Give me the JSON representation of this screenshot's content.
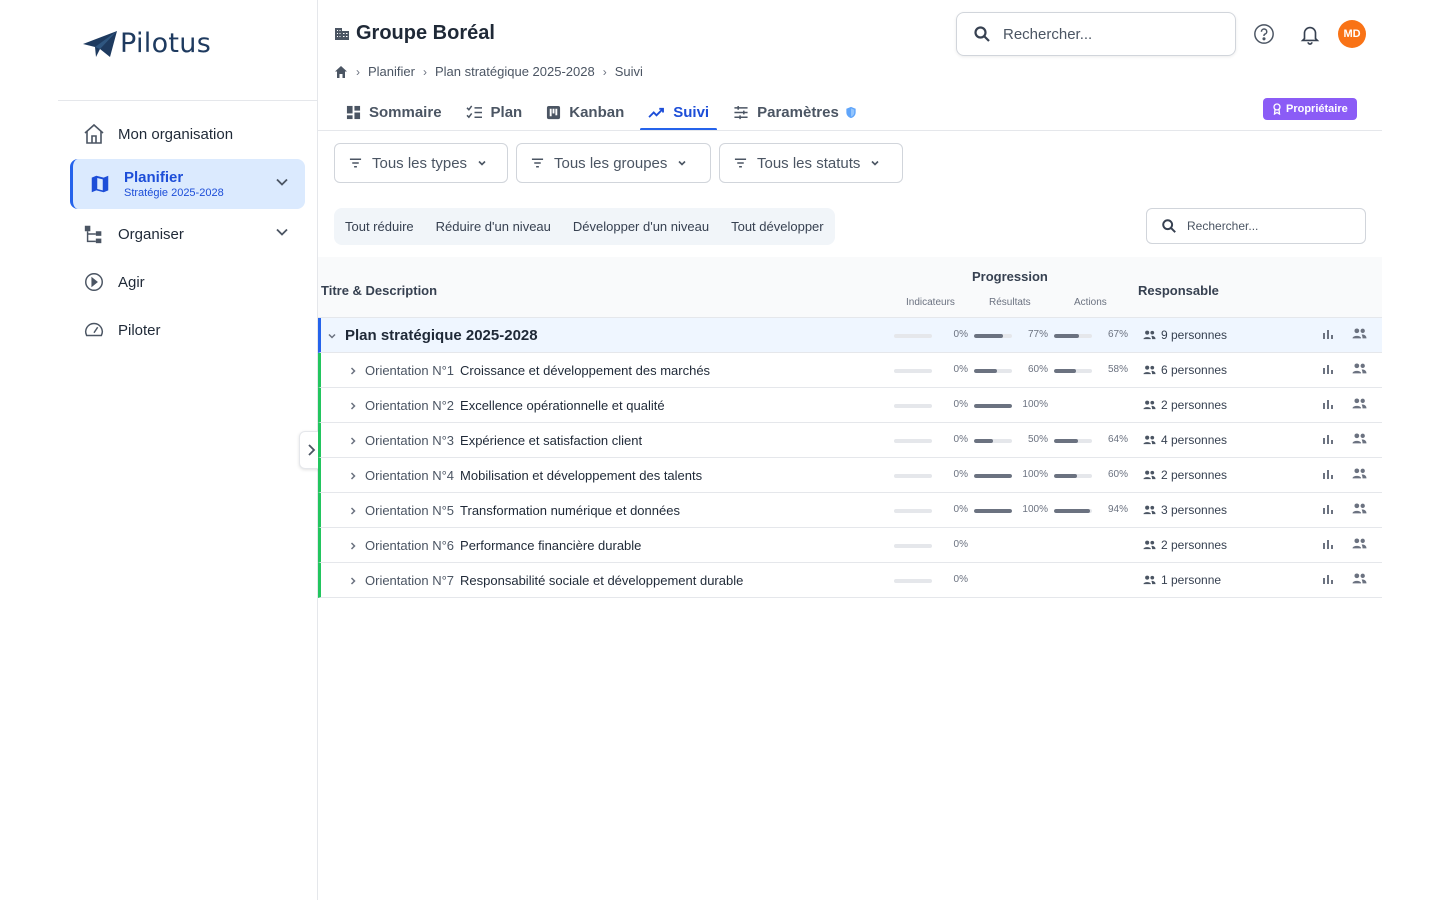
{
  "app": {
    "logo_text": "Pilotus"
  },
  "sidebar": {
    "items": [
      {
        "label": "Mon organisation",
        "icon": "home-icon"
      },
      {
        "label": "Planifier",
        "sublabel": "Stratégie 2025-2028",
        "icon": "map-icon",
        "active": true
      },
      {
        "label": "Organiser",
        "icon": "hierarchy-icon"
      },
      {
        "label": "Agir",
        "icon": "play-icon"
      },
      {
        "label": "Piloter",
        "icon": "gauge-icon"
      }
    ]
  },
  "header": {
    "title": "Groupe Boréal",
    "search_placeholder": "Rechercher...",
    "avatar_initials": "MD"
  },
  "breadcrumb": [
    "Planifier",
    "Plan stratégique 2025-2028",
    "Suivi"
  ],
  "tabs": [
    {
      "label": "Sommaire",
      "icon": "dashboard-icon"
    },
    {
      "label": "Plan",
      "icon": "checklist-icon"
    },
    {
      "label": "Kanban",
      "icon": "kanban-icon"
    },
    {
      "label": "Suivi",
      "icon": "trending-up-icon",
      "active": true
    },
    {
      "label": "Paramètres",
      "icon": "sliders-icon"
    }
  ],
  "owner_badge": "Propriétaire",
  "filters": [
    "Tous les types",
    "Tous les groupes",
    "Tous les statuts"
  ],
  "actions": [
    "Tout réduire",
    "Réduire d'un niveau",
    "Développer d'un niveau",
    "Tout développer"
  ],
  "table": {
    "search_placeholder": "Rechercher...",
    "col_title": "Titre & Description",
    "col_progress": "Progression",
    "col_indicators": "Indicateurs",
    "col_results": "Résultats",
    "col_actions": "Actions",
    "col_owner": "Responsable",
    "root": {
      "title": "Plan stratégique 2025-2028",
      "indicators": 0,
      "indicators_label": "0%",
      "results": 77,
      "results_label": "77%",
      "actions": 67,
      "actions_label": "67%",
      "owner": "9 personnes"
    },
    "rows": [
      {
        "prefix": "Orientation N°1",
        "title": "Croissance et développement des marchés",
        "indicators": 0,
        "indicators_label": "0%",
        "results": 60,
        "results_label": "60%",
        "actions": 58,
        "actions_label": "58%",
        "owner": "6 personnes"
      },
      {
        "prefix": "Orientation N°2",
        "title": "Excellence opérationnelle et qualité",
        "indicators": 0,
        "indicators_label": "0%",
        "results": 100,
        "results_label": "100%",
        "actions": null,
        "actions_label": "",
        "owner": "2 personnes"
      },
      {
        "prefix": "Orientation N°3",
        "title": "Expérience et satisfaction client",
        "indicators": 0,
        "indicators_label": "0%",
        "results": 50,
        "results_label": "50%",
        "actions": 64,
        "actions_label": "64%",
        "owner": "4 personnes"
      },
      {
        "prefix": "Orientation N°4",
        "title": "Mobilisation et développement des talents",
        "indicators": 0,
        "indicators_label": "0%",
        "results": 100,
        "results_label": "100%",
        "actions": 60,
        "actions_label": "60%",
        "owner": "2 personnes"
      },
      {
        "prefix": "Orientation N°5",
        "title": "Transformation numérique et données",
        "indicators": 0,
        "indicators_label": "0%",
        "results": 100,
        "results_label": "100%",
        "actions": 94,
        "actions_label": "94%",
        "owner": "3 personnes"
      },
      {
        "prefix": "Orientation N°6",
        "title": "Performance financière durable",
        "indicators": 0,
        "indicators_label": "0%",
        "results": null,
        "results_label": "",
        "actions": null,
        "actions_label": "",
        "owner": "2 personnes"
      },
      {
        "prefix": "Orientation N°7",
        "title": "Responsabilité sociale et développement durable",
        "indicators": 0,
        "indicators_label": "0%",
        "results": null,
        "results_label": "",
        "actions": null,
        "actions_label": "",
        "owner": "1 personne"
      }
    ]
  },
  "colors": {
    "accent": "#2563eb",
    "active_bg": "#dbeafe",
    "child_border": "#22c55e",
    "avatar": "#f97316",
    "badge": "#8b5cf6"
  }
}
